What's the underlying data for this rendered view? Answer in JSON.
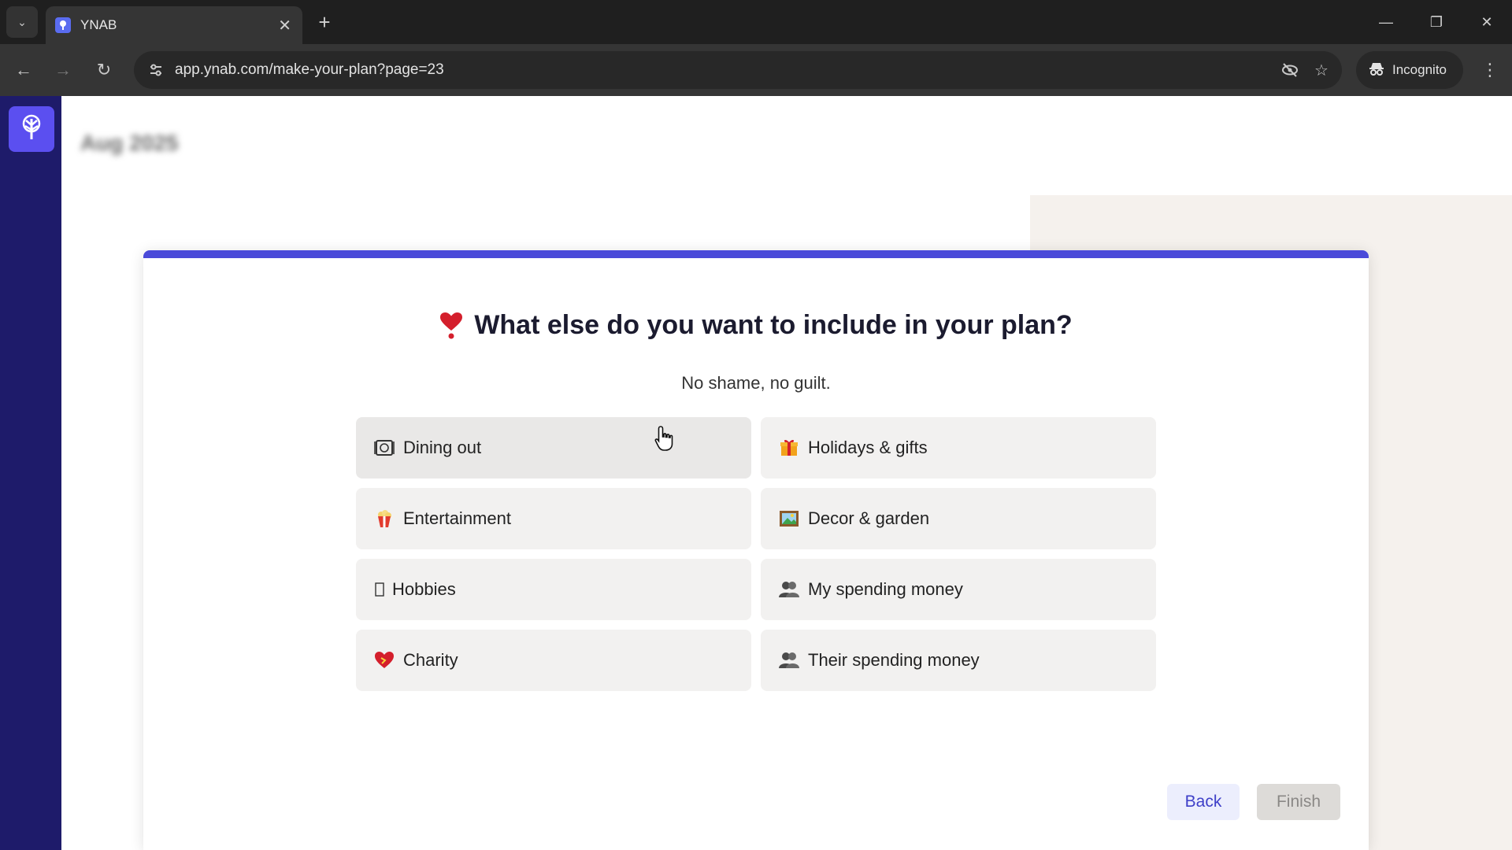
{
  "browser": {
    "tab_title": "YNAB",
    "url": "app.ynab.com/make-your-plan?page=23",
    "incognito_label": "Incognito"
  },
  "app": {
    "header_month": "Aug 2025"
  },
  "modal": {
    "progress_fraction": 1.0,
    "title": "What else do you want to include in your plan?",
    "subtitle": "No shame, no guilt.",
    "options": [
      {
        "label": "Dining out",
        "icon": "plate-cutlery-icon"
      },
      {
        "label": "Holidays & gifts",
        "icon": "gift-icon"
      },
      {
        "label": "Entertainment",
        "icon": "popcorn-icon"
      },
      {
        "label": "Decor & garden",
        "icon": "framed-picture-icon"
      },
      {
        "label": "Hobbies",
        "icon": "placeholder-glyph-icon"
      },
      {
        "label": "My spending money",
        "icon": "people-icon"
      },
      {
        "label": "Charity",
        "icon": "heart-icon"
      },
      {
        "label": "Their spending money",
        "icon": "people-icon"
      }
    ],
    "back_label": "Back",
    "finish_label": "Finish"
  },
  "colors": {
    "sidebar": "#1e1b6a",
    "accent": "#4a4ad9",
    "heart": "#d41f2c"
  }
}
